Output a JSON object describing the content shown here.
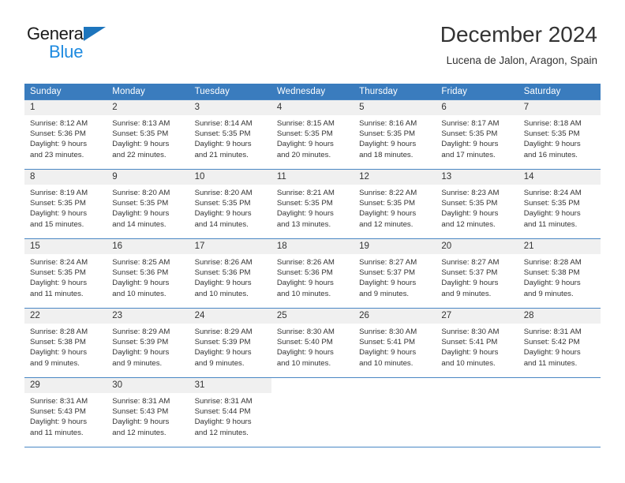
{
  "brand": {
    "name_top": "General",
    "name_bottom": "Blue",
    "accent_color": "#1d8ae0",
    "triangle_color": "#1d75bd"
  },
  "header": {
    "title": "December 2024",
    "subtitle": "Lucena de Jalon, Aragon, Spain"
  },
  "calendar": {
    "header_bg": "#3a7cbe",
    "daynum_bg": "#f0f0f0",
    "weekdays": [
      "Sunday",
      "Monday",
      "Tuesday",
      "Wednesday",
      "Thursday",
      "Friday",
      "Saturday"
    ],
    "weeks": [
      [
        {
          "day": "1",
          "sunrise": "Sunrise: 8:12 AM",
          "sunset": "Sunset: 5:36 PM",
          "daylight1": "Daylight: 9 hours",
          "daylight2": "and 23 minutes."
        },
        {
          "day": "2",
          "sunrise": "Sunrise: 8:13 AM",
          "sunset": "Sunset: 5:35 PM",
          "daylight1": "Daylight: 9 hours",
          "daylight2": "and 22 minutes."
        },
        {
          "day": "3",
          "sunrise": "Sunrise: 8:14 AM",
          "sunset": "Sunset: 5:35 PM",
          "daylight1": "Daylight: 9 hours",
          "daylight2": "and 21 minutes."
        },
        {
          "day": "4",
          "sunrise": "Sunrise: 8:15 AM",
          "sunset": "Sunset: 5:35 PM",
          "daylight1": "Daylight: 9 hours",
          "daylight2": "and 20 minutes."
        },
        {
          "day": "5",
          "sunrise": "Sunrise: 8:16 AM",
          "sunset": "Sunset: 5:35 PM",
          "daylight1": "Daylight: 9 hours",
          "daylight2": "and 18 minutes."
        },
        {
          "day": "6",
          "sunrise": "Sunrise: 8:17 AM",
          "sunset": "Sunset: 5:35 PM",
          "daylight1": "Daylight: 9 hours",
          "daylight2": "and 17 minutes."
        },
        {
          "day": "7",
          "sunrise": "Sunrise: 8:18 AM",
          "sunset": "Sunset: 5:35 PM",
          "daylight1": "Daylight: 9 hours",
          "daylight2": "and 16 minutes."
        }
      ],
      [
        {
          "day": "8",
          "sunrise": "Sunrise: 8:19 AM",
          "sunset": "Sunset: 5:35 PM",
          "daylight1": "Daylight: 9 hours",
          "daylight2": "and 15 minutes."
        },
        {
          "day": "9",
          "sunrise": "Sunrise: 8:20 AM",
          "sunset": "Sunset: 5:35 PM",
          "daylight1": "Daylight: 9 hours",
          "daylight2": "and 14 minutes."
        },
        {
          "day": "10",
          "sunrise": "Sunrise: 8:20 AM",
          "sunset": "Sunset: 5:35 PM",
          "daylight1": "Daylight: 9 hours",
          "daylight2": "and 14 minutes."
        },
        {
          "day": "11",
          "sunrise": "Sunrise: 8:21 AM",
          "sunset": "Sunset: 5:35 PM",
          "daylight1": "Daylight: 9 hours",
          "daylight2": "and 13 minutes."
        },
        {
          "day": "12",
          "sunrise": "Sunrise: 8:22 AM",
          "sunset": "Sunset: 5:35 PM",
          "daylight1": "Daylight: 9 hours",
          "daylight2": "and 12 minutes."
        },
        {
          "day": "13",
          "sunrise": "Sunrise: 8:23 AM",
          "sunset": "Sunset: 5:35 PM",
          "daylight1": "Daylight: 9 hours",
          "daylight2": "and 12 minutes."
        },
        {
          "day": "14",
          "sunrise": "Sunrise: 8:24 AM",
          "sunset": "Sunset: 5:35 PM",
          "daylight1": "Daylight: 9 hours",
          "daylight2": "and 11 minutes."
        }
      ],
      [
        {
          "day": "15",
          "sunrise": "Sunrise: 8:24 AM",
          "sunset": "Sunset: 5:35 PM",
          "daylight1": "Daylight: 9 hours",
          "daylight2": "and 11 minutes."
        },
        {
          "day": "16",
          "sunrise": "Sunrise: 8:25 AM",
          "sunset": "Sunset: 5:36 PM",
          "daylight1": "Daylight: 9 hours",
          "daylight2": "and 10 minutes."
        },
        {
          "day": "17",
          "sunrise": "Sunrise: 8:26 AM",
          "sunset": "Sunset: 5:36 PM",
          "daylight1": "Daylight: 9 hours",
          "daylight2": "and 10 minutes."
        },
        {
          "day": "18",
          "sunrise": "Sunrise: 8:26 AM",
          "sunset": "Sunset: 5:36 PM",
          "daylight1": "Daylight: 9 hours",
          "daylight2": "and 10 minutes."
        },
        {
          "day": "19",
          "sunrise": "Sunrise: 8:27 AM",
          "sunset": "Sunset: 5:37 PM",
          "daylight1": "Daylight: 9 hours",
          "daylight2": "and 9 minutes."
        },
        {
          "day": "20",
          "sunrise": "Sunrise: 8:27 AM",
          "sunset": "Sunset: 5:37 PM",
          "daylight1": "Daylight: 9 hours",
          "daylight2": "and 9 minutes."
        },
        {
          "day": "21",
          "sunrise": "Sunrise: 8:28 AM",
          "sunset": "Sunset: 5:38 PM",
          "daylight1": "Daylight: 9 hours",
          "daylight2": "and 9 minutes."
        }
      ],
      [
        {
          "day": "22",
          "sunrise": "Sunrise: 8:28 AM",
          "sunset": "Sunset: 5:38 PM",
          "daylight1": "Daylight: 9 hours",
          "daylight2": "and 9 minutes."
        },
        {
          "day": "23",
          "sunrise": "Sunrise: 8:29 AM",
          "sunset": "Sunset: 5:39 PM",
          "daylight1": "Daylight: 9 hours",
          "daylight2": "and 9 minutes."
        },
        {
          "day": "24",
          "sunrise": "Sunrise: 8:29 AM",
          "sunset": "Sunset: 5:39 PM",
          "daylight1": "Daylight: 9 hours",
          "daylight2": "and 9 minutes."
        },
        {
          "day": "25",
          "sunrise": "Sunrise: 8:30 AM",
          "sunset": "Sunset: 5:40 PM",
          "daylight1": "Daylight: 9 hours",
          "daylight2": "and 10 minutes."
        },
        {
          "day": "26",
          "sunrise": "Sunrise: 8:30 AM",
          "sunset": "Sunset: 5:41 PM",
          "daylight1": "Daylight: 9 hours",
          "daylight2": "and 10 minutes."
        },
        {
          "day": "27",
          "sunrise": "Sunrise: 8:30 AM",
          "sunset": "Sunset: 5:41 PM",
          "daylight1": "Daylight: 9 hours",
          "daylight2": "and 10 minutes."
        },
        {
          "day": "28",
          "sunrise": "Sunrise: 8:31 AM",
          "sunset": "Sunset: 5:42 PM",
          "daylight1": "Daylight: 9 hours",
          "daylight2": "and 11 minutes."
        }
      ],
      [
        {
          "day": "29",
          "sunrise": "Sunrise: 8:31 AM",
          "sunset": "Sunset: 5:43 PM",
          "daylight1": "Daylight: 9 hours",
          "daylight2": "and 11 minutes."
        },
        {
          "day": "30",
          "sunrise": "Sunrise: 8:31 AM",
          "sunset": "Sunset: 5:43 PM",
          "daylight1": "Daylight: 9 hours",
          "daylight2": "and 12 minutes."
        },
        {
          "day": "31",
          "sunrise": "Sunrise: 8:31 AM",
          "sunset": "Sunset: 5:44 PM",
          "daylight1": "Daylight: 9 hours",
          "daylight2": "and 12 minutes."
        },
        {
          "day": "",
          "sunrise": "",
          "sunset": "",
          "daylight1": "",
          "daylight2": ""
        },
        {
          "day": "",
          "sunrise": "",
          "sunset": "",
          "daylight1": "",
          "daylight2": ""
        },
        {
          "day": "",
          "sunrise": "",
          "sunset": "",
          "daylight1": "",
          "daylight2": ""
        },
        {
          "day": "",
          "sunrise": "",
          "sunset": "",
          "daylight1": "",
          "daylight2": ""
        }
      ]
    ]
  }
}
